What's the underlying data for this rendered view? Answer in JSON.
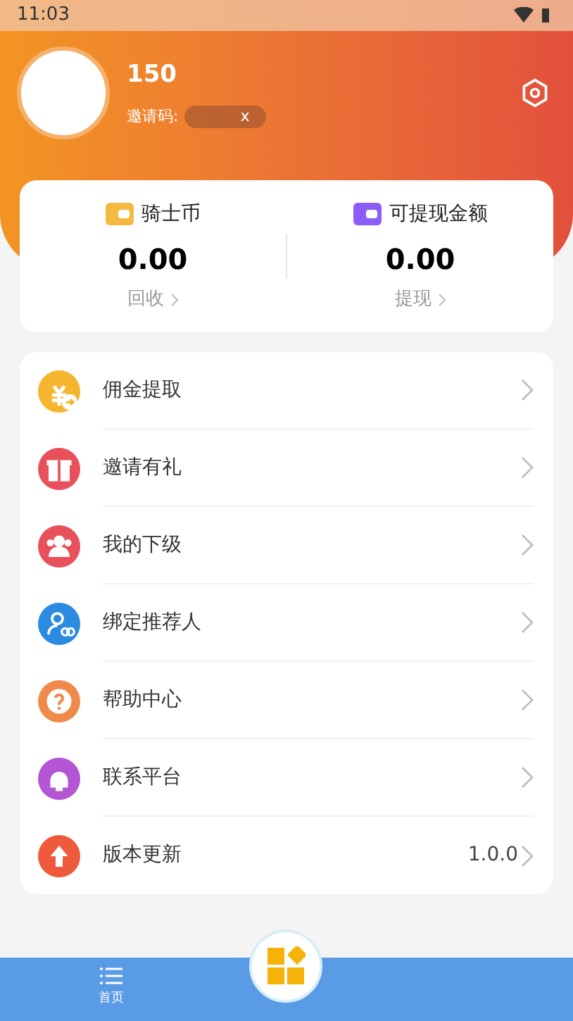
{
  "status_bar": {
    "time": "11:03"
  },
  "profile": {
    "name": "150",
    "invite_label": "邀请码:",
    "invite_code": "x"
  },
  "balances": [
    {
      "label": "骑士币",
      "amount": "0.00",
      "action": "回收",
      "color": "#f5b942"
    },
    {
      "label": "可提现金额",
      "amount": "0.00",
      "action": "提现",
      "color": "#8b5cf6"
    }
  ],
  "menu": [
    {
      "kind": "commission",
      "label": "佣金提取",
      "color": "#f5b52e"
    },
    {
      "kind": "gift",
      "label": "邀请有礼",
      "color": "#e8505b"
    },
    {
      "kind": "team",
      "label": "我的下级",
      "color": "#e8505b"
    },
    {
      "kind": "bind",
      "label": "绑定推荐人",
      "color": "#2b8be0"
    },
    {
      "kind": "help",
      "label": "帮助中心",
      "color": "#f08a4b"
    },
    {
      "kind": "contact",
      "label": "联系平台",
      "color": "#b455d4"
    },
    {
      "kind": "update",
      "label": "版本更新",
      "color": "#ef5a3c",
      "value": "1.0.0"
    }
  ],
  "bottom_nav": [
    {
      "label": "首页"
    }
  ]
}
